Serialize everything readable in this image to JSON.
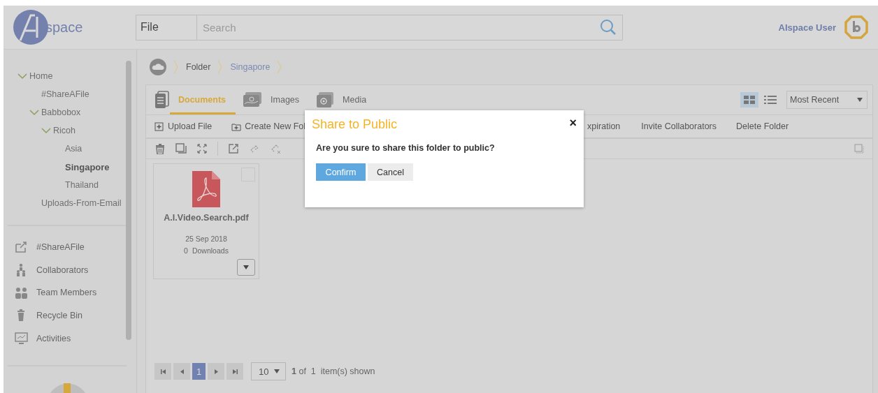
{
  "header": {
    "logo_text": "space",
    "search": {
      "scope": "File",
      "placeholder": "Search"
    },
    "user": "AIspace User"
  },
  "sidebar": {
    "tree": [
      {
        "label": "Home",
        "expanded": true,
        "selected": false,
        "children": [
          {
            "label": "#ShareAFile",
            "selected": false
          },
          {
            "label": "Babbobox",
            "expanded": true,
            "selected": false,
            "children": [
              {
                "label": "Ricoh",
                "expanded": true,
                "selected": false,
                "children": [
                  {
                    "label": "Asia",
                    "selected": false
                  },
                  {
                    "label": "Singapore",
                    "selected": true
                  },
                  {
                    "label": "Thailand",
                    "selected": false
                  }
                ]
              }
            ]
          },
          {
            "label": "Uploads-From-Email",
            "selected": false
          }
        ]
      }
    ],
    "nav": [
      {
        "kind": "share",
        "label": "#ShareAFile"
      },
      {
        "kind": "collaborators",
        "label": "Collaborators"
      },
      {
        "kind": "team",
        "label": "Team Members"
      },
      {
        "kind": "bin",
        "label": "Recycle Bin"
      },
      {
        "kind": "activity",
        "label": "Activities"
      }
    ]
  },
  "breadcrumb": [
    {
      "label": "Folder",
      "current": false
    },
    {
      "label": "Singapore",
      "current": true
    }
  ],
  "tabs": [
    {
      "kind": "documents",
      "label": "Documents",
      "selected": true
    },
    {
      "kind": "images",
      "label": "Images",
      "selected": false
    },
    {
      "kind": "media",
      "label": "Media",
      "selected": false
    }
  ],
  "views": [
    {
      "kind": "grid",
      "selected": true
    },
    {
      "kind": "list",
      "selected": false
    }
  ],
  "sort": "Most Recent",
  "actions": [
    {
      "kind": "upload",
      "label": "Upload File"
    },
    {
      "kind": "new-folder",
      "label": "Create New Fol"
    },
    {
      "kind": "cut",
      "label": "xpiration"
    },
    {
      "kind": "plain",
      "label": "Invite Collaborators"
    },
    {
      "kind": "plain",
      "label": "Delete Folder"
    }
  ],
  "files": [
    {
      "name": "A.I.Video.Search.pdf",
      "date": "25 Sep 2018",
      "downloads": "0",
      "downloads_label": "Downloads",
      "checked": false
    }
  ],
  "pager": {
    "page": "1",
    "page_size": "10",
    "summary": "**1** of  1  item(s) shown"
  },
  "modal": {
    "title": "Share to Public",
    "close": "×",
    "message": "Are you sure to share this folder to public?",
    "confirm": "Confirm",
    "cancel": "Cancel"
  }
}
